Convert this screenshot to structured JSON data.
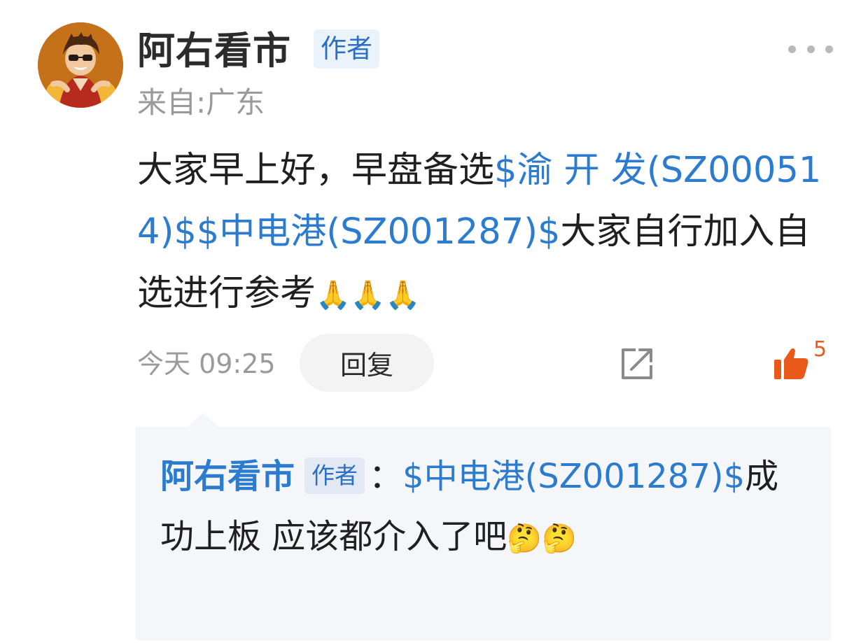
{
  "post": {
    "author": "阿右看市",
    "author_badge": "作者",
    "location": "来自:广东",
    "content": {
      "intro": "大家早上好，早盘备选",
      "stock1": "$渝 开 发(SZ000514)$",
      "stock2": "$中电港(SZ001287)$",
      "outro": "大家自行加入自选进行参考",
      "emojis": "🙏🙏🙏"
    },
    "timestamp": "今天 09:25",
    "reply_label": "回复",
    "like_count": "5",
    "more_icon": "more-dots-icon",
    "share_icon": "share-icon",
    "like_icon": "thumbs-up-icon",
    "accent_color": "#2b7bd0",
    "like_color": "#e8591a"
  },
  "reply": {
    "author": "阿右看市",
    "author_badge": "作者",
    "separator": "：",
    "stock": "$中电港(SZ001287)$",
    "text": "成功上板 应该都介入了吧",
    "emojis": "🤔🤔"
  }
}
